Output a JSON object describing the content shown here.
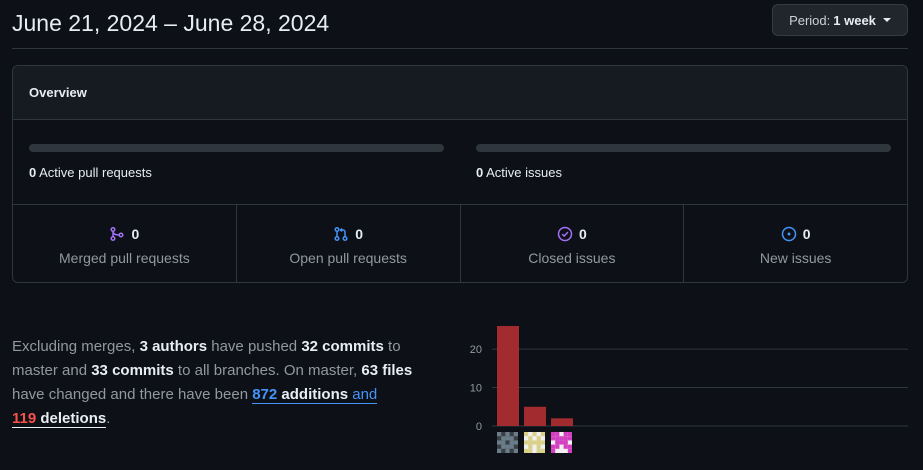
{
  "header": {
    "date_range": "June 21, 2024 – June 28, 2024",
    "period_label": "Period:",
    "period_value": "1 week"
  },
  "overview": {
    "title": "Overview",
    "active_prs_count": "0",
    "active_prs_label": "Active pull requests",
    "active_prs_fill_fraction": 0,
    "active_issues_count": "0",
    "active_issues_label": "Active issues",
    "active_issues_fill_fraction": 0,
    "stats": [
      {
        "count": "0",
        "label": "Merged pull requests",
        "icon": "git-merge-icon",
        "color": "#a371f7"
      },
      {
        "count": "0",
        "label": "Open pull requests",
        "icon": "git-pull-request-icon",
        "color": "#4493f8"
      },
      {
        "count": "0",
        "label": "Closed issues",
        "icon": "issue-closed-icon",
        "color": "#a371f7"
      },
      {
        "count": "0",
        "label": "New issues",
        "icon": "issue-opened-icon",
        "color": "#4493f8"
      }
    ]
  },
  "summary": {
    "t1": "Excluding merges, ",
    "authors": "3 authors",
    "t2": " have pushed ",
    "commits_master": "32 commits",
    "t3": " to master and ",
    "commits_all": "33 commits",
    "t4": " to all branches. On master, ",
    "files": "63 files",
    "t5": " have changed and there have been ",
    "additions_num": "872",
    "additions_word": "additions",
    "t6": " and",
    "deletions_num": "119",
    "deletions_word": "deletions",
    "t7": "."
  },
  "chart_data": {
    "type": "bar",
    "categories": [
      "author-1",
      "author-2",
      "author-3"
    ],
    "values": [
      26,
      5,
      2
    ],
    "ylim": [
      0,
      26
    ],
    "yticks": [
      "0",
      "10",
      "20"
    ],
    "bar_color": "#a12b2f",
    "grid": true
  },
  "colors": {
    "background": "#0d1117",
    "border": "#30363d",
    "accent_blue": "#4493f8",
    "deletion_red": "#f85149"
  }
}
